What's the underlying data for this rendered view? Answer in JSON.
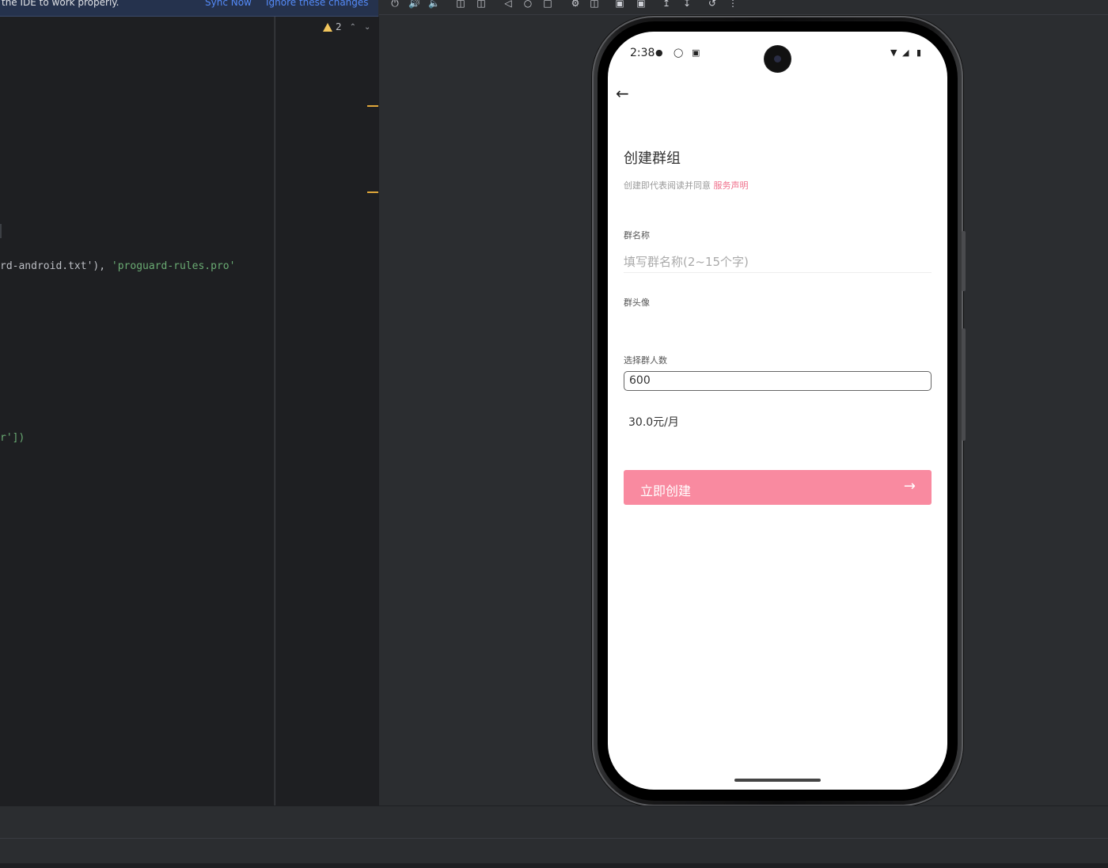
{
  "ide": {
    "notice_text": "the IDE to work properly.",
    "sync_now": "Sync Now",
    "ignore_changes": "Ignore these changes",
    "warning_count": "2",
    "code_lines": [
      {
        "plain_prefix": "rd-android.txt'), ",
        "string_part": "'proguard-rules.pro'"
      },
      {
        "plain_prefix": "r'])",
        "string_part": ""
      }
    ]
  },
  "emulator_toolbar": {
    "icons": [
      "power-icon",
      "volume-up-icon",
      "volume-down-icon",
      "rotate-left-icon",
      "rotate-right-icon",
      "back-icon",
      "home-icon",
      "overview-icon",
      "snapshot-icon",
      "fold-icon",
      "screenshot-icon",
      "record-icon",
      "export-icon",
      "import-icon",
      "reset-icon",
      "more-icon"
    ]
  },
  "phone": {
    "status": {
      "time": "2:38"
    },
    "page": {
      "title": "创建群组",
      "agree_prefix": "创建即代表阅读并同意 ",
      "agree_link": "服务声明",
      "name_label": "群名称",
      "name_placeholder": "填写群名称(2~15个字)",
      "avatar_label": "群头像",
      "count_label": "选择群人数",
      "count_value": "600",
      "price": "30.0元/月",
      "create_button": "立即创建"
    }
  },
  "colors": {
    "accent_pink": "#f98aa0",
    "link_pink": "#f0708c",
    "ide_bg": "#1e1f22",
    "ide_link": "#548af7"
  }
}
